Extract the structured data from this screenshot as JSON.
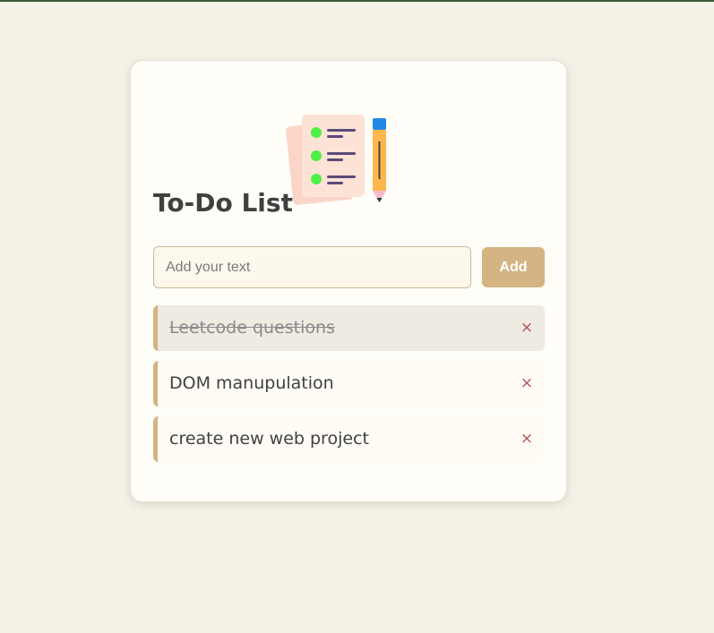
{
  "app": {
    "title": "To-Do List",
    "accent_color": "#d4b483",
    "delete_color": "#b25353",
    "background_color": "#f4f1e6"
  },
  "input": {
    "placeholder": "Add your text",
    "value": ""
  },
  "add_button": {
    "label": "Add"
  },
  "illustration": {
    "icon": "checklist-with-pencil-icon"
  },
  "tasks": [
    {
      "text": "Leetcode questions",
      "completed": true,
      "delete_icon": "×"
    },
    {
      "text": "DOM manupulation",
      "completed": false,
      "delete_icon": "×"
    },
    {
      "text": "create new web project",
      "completed": false,
      "delete_icon": "×"
    }
  ]
}
